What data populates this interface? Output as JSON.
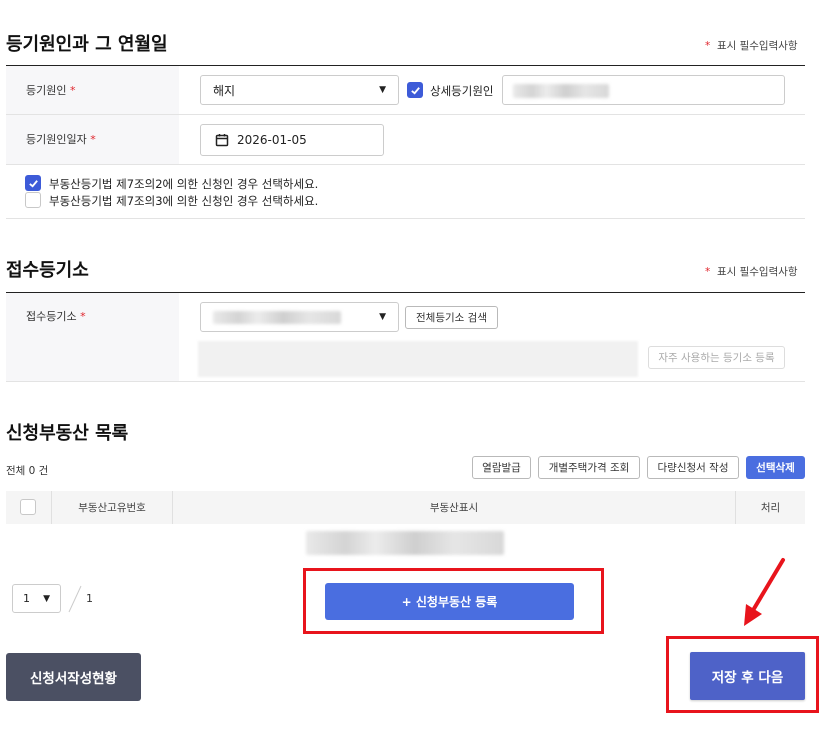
{
  "section1": {
    "title": "등기원인과 그 연월일",
    "required_note": "표시 필수입력사항",
    "cause_label": "등기원인",
    "cause_value": "해지",
    "detail_checkbox_label": "상세등기원인",
    "date_label": "등기원인일자",
    "date_value": "2026-01-05",
    "law_option_1": "부동산등기법 제7조의2에 의한 신청인 경우 선택하세요.",
    "law_option_2": "부동산등기법 제7조의3에 의한 신청인 경우 선택하세요."
  },
  "section2": {
    "title": "접수등기소",
    "required_note": "표시 필수입력사항",
    "office_label": "접수등기소",
    "search_all_button": "전체등기소 검색",
    "register_frequent_button": "자주 사용하는 등기소 등록"
  },
  "section3": {
    "title": "신청부동산 목록",
    "total_count": "전체 0 건",
    "buttons": {
      "view_issue": "열람발급",
      "individual_price": "개별주택가격 조회",
      "bulk_application": "다량신청서 작성",
      "delete_selected": "선택삭제"
    },
    "columns": [
      "부동산고유번호",
      "부동산표시",
      "처리"
    ],
    "page_select": "1",
    "page_total": "1",
    "register_button": "+ 신청부동산 등록"
  },
  "footer": {
    "status_button": "신청서작성현황",
    "save_next_button": "저장 후 다음"
  },
  "marks": {
    "required_star": "*"
  },
  "colors": {
    "accent": "#4a6ee0",
    "highlight": "#e8141c",
    "dark_button": "#4b5063"
  }
}
